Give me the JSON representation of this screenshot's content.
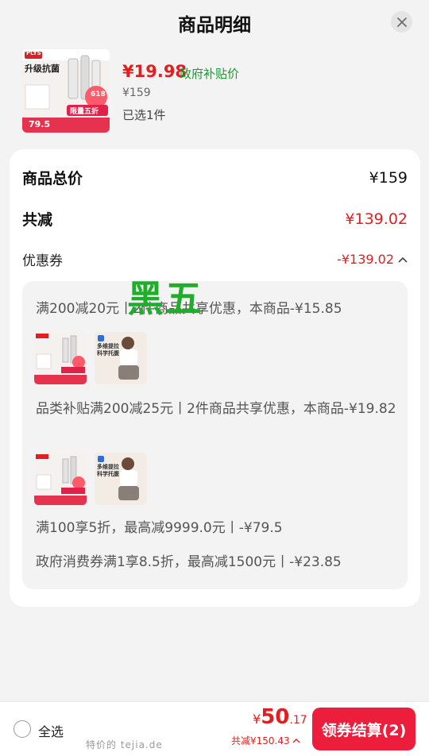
{
  "header": {
    "title": "商品明细"
  },
  "product": {
    "price": "¥19.98",
    "price_tag": "政府补贴价",
    "original_price": "¥159",
    "selected": "已选1件",
    "thumb_brand": "PLYS",
    "thumb_headline": "升级抗菌",
    "thumb_badge": "限量五折",
    "thumb_price": "79.5",
    "thumb_event": "618"
  },
  "summary": {
    "total_label": "商品总价",
    "total_value": "¥159",
    "reduce_label": "共减",
    "reduce_value": "¥139.02",
    "coupon_label": "优惠券",
    "coupon_value": "-¥139.02"
  },
  "coupons": {
    "line1": "满200减20元丨2件商品共享优惠，本商品-¥15.85",
    "line2": "品类补贴满200减25元丨2件商品共享优惠，本商品-¥19.82",
    "line3": "满100享5折，最高减9999.0元丨-¥79.5",
    "line4": "政府消费券满1享8.5折，最高减1500元丨-¥23.85",
    "mini2_text": "多维提拉 科学托腹"
  },
  "watermark": "黑五",
  "bottom": {
    "select_all": "全选",
    "currency": "¥",
    "total_int": "50",
    "total_dec": ".17",
    "reduce_text": "共减¥150.43",
    "checkout_label": "领券结算(2)",
    "site_mark": "特价的 tejia.de"
  },
  "colors": {
    "accent_red": "#e02020",
    "button_red": "#ec1e3c",
    "green": "#1a9a2e"
  }
}
